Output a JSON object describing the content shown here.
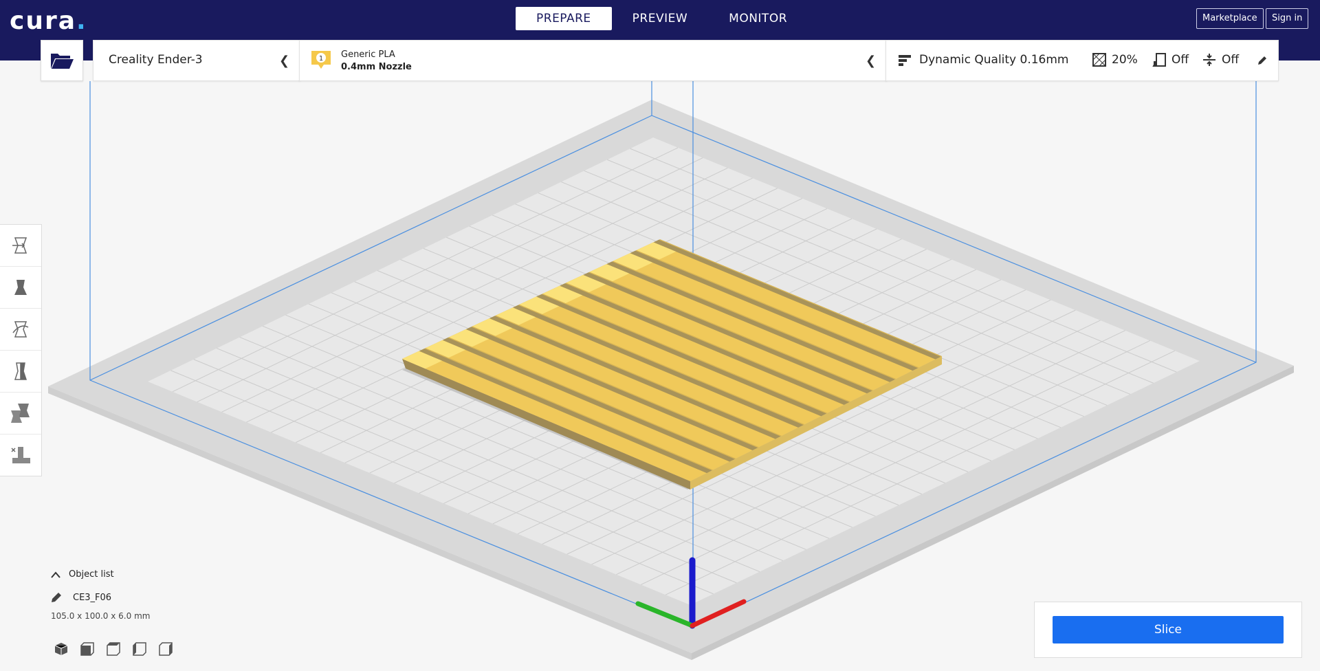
{
  "app": {
    "logo_text": "cura",
    "logo_dot": "."
  },
  "stages": [
    "PREPARE",
    "PREVIEW",
    "MONITOR"
  ],
  "active_stage": "PREPARE",
  "header_buttons": {
    "marketplace": "Marketplace",
    "signin": "Sign in"
  },
  "printer": {
    "name": "Creality Ender-3"
  },
  "material": {
    "extruder_number": "1",
    "name": "Generic PLA",
    "nozzle": "0.4mm Nozzle"
  },
  "print_settings": {
    "profile": "Dynamic Quality 0.16mm",
    "infill": "20%",
    "support": "Off",
    "adhesion": "Off"
  },
  "object_list": {
    "title": "Object list",
    "object_name": "CE3_F06",
    "dimensions": "105.0 x 100.0 x 6.0 mm"
  },
  "slice": {
    "label": "Slice"
  },
  "colors": {
    "topbar": "#191a5e",
    "accent": "#196ef0",
    "model": "#f5c84a",
    "model_dark": "#b89a4c",
    "bed": "#e6e6e6"
  }
}
